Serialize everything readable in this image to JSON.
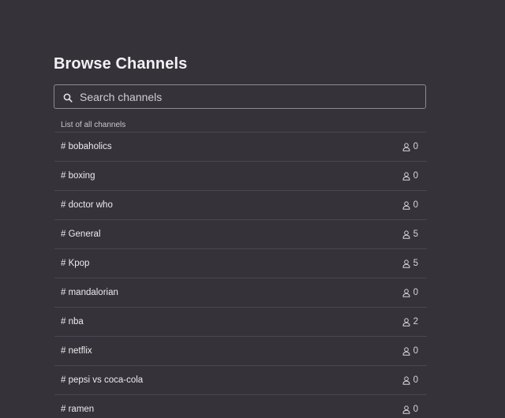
{
  "page": {
    "title": "Browse Channels"
  },
  "search": {
    "placeholder": "Search channels",
    "value": "",
    "icon": "search-icon"
  },
  "list": {
    "caption": "List of all channels",
    "member_icon": "user-icon",
    "channels": [
      {
        "name": "# bobaholics",
        "members": "0"
      },
      {
        "name": "# boxing",
        "members": "0"
      },
      {
        "name": "# doctor who",
        "members": "0"
      },
      {
        "name": "# General",
        "members": "5"
      },
      {
        "name": "# Kpop",
        "members": "5"
      },
      {
        "name": "# mandalorian",
        "members": "0"
      },
      {
        "name": "# nba",
        "members": "2"
      },
      {
        "name": "# netflix",
        "members": "0"
      },
      {
        "name": "# pepsi vs coca-cola",
        "members": "0"
      },
      {
        "name": "# ramen",
        "members": "0"
      }
    ]
  },
  "colors": {
    "background": "#35323a",
    "text": "#ececee",
    "divider": "#4a4750",
    "search_border": "#8d8a92"
  }
}
